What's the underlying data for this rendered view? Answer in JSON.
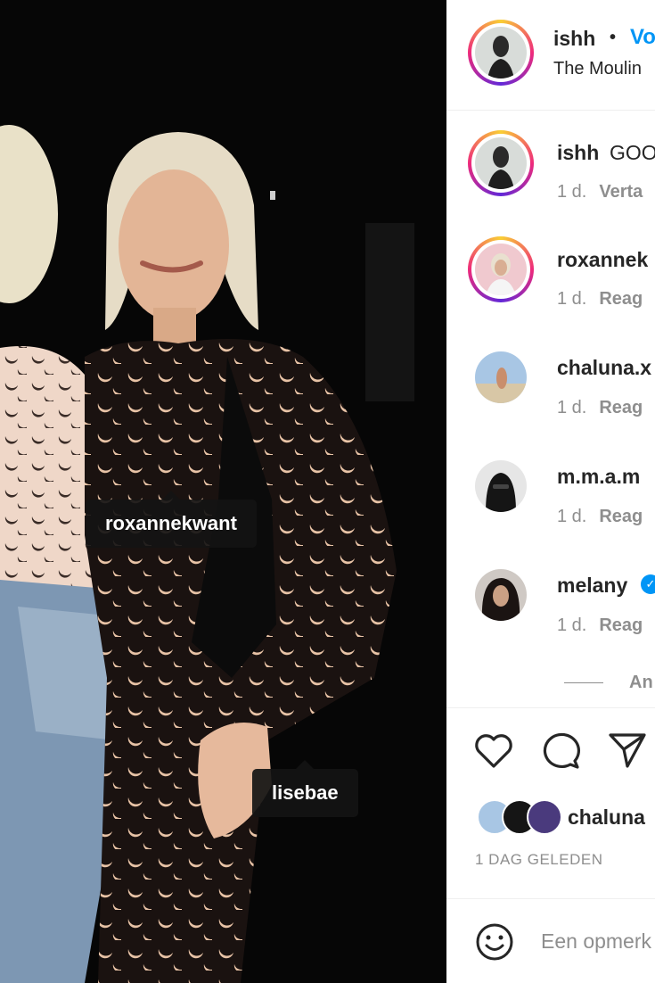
{
  "post": {
    "tags": [
      "roxannekwant",
      "lisebae"
    ]
  },
  "header": {
    "username": "ishh",
    "separator": "•",
    "follow_label": "Vo",
    "location": "The Moulin"
  },
  "caption": {
    "username": "ishh",
    "text": "GOO",
    "time": "1 d.",
    "action": "Verta"
  },
  "comments": [
    {
      "username": "roxannek",
      "time": "1 d.",
      "action": "Reag"
    },
    {
      "username": "chaluna.x",
      "time": "1 d.",
      "action": "Reag"
    },
    {
      "username": "m.m.a.m",
      "time": "1 d.",
      "action": "Reag"
    },
    {
      "username": "melany",
      "time": "1 d.",
      "action": "Reag",
      "verified": true
    }
  ],
  "more_replies_label": "An",
  "actions": {
    "icons": [
      "heart-icon",
      "comment-icon",
      "share-icon"
    ]
  },
  "likes": {
    "username": "chaluna"
  },
  "timestamp": "1 DAG GELEDEN",
  "comment_box": {
    "placeholder": "Een opmerk"
  },
  "colors": {
    "accent": "#0095f6",
    "muted": "#8e8e8e",
    "text": "#262626"
  }
}
